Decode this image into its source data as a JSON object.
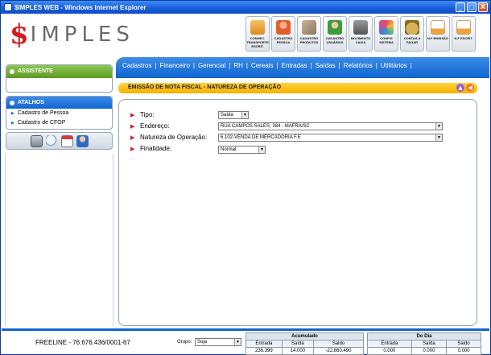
{
  "window": {
    "title": "$IMPLES WEB - Windows Internet Explorer",
    "buttons": [
      "_",
      "□",
      "X"
    ]
  },
  "logo": {
    "symbol": "$",
    "text": "IMPLES"
  },
  "toolbar": [
    {
      "label": "CONHEC. TRANSPORTE ESCRIT.",
      "icon": "truck-icon",
      "color": "#f0a23c"
    },
    {
      "label": "CADASTRO PESSOA",
      "icon": "person-icon",
      "color": "#e35d2a"
    },
    {
      "label": "CADASTRO PRODUTOS",
      "icon": "box-icon",
      "color": "#9f8a72"
    },
    {
      "label": "CADASTRO USUÁRIOS",
      "icon": "user-icon",
      "color": "#3e9c3e"
    },
    {
      "label": "MOVIMENTO CAIXA",
      "icon": "safe-icon",
      "color": "#7a7a7a"
    },
    {
      "label": "CONFIG SISTEMA",
      "icon": "palette-icon",
      "color": "#c94f9d"
    },
    {
      "label": "CONTAS A PAGAR",
      "icon": "money-bag-icon",
      "color": "#b58a2c"
    },
    {
      "label": "N.F EMISSÃO",
      "icon": "invoice-icon",
      "color": "#e8a23c"
    },
    {
      "label": "N.F ESCRIT.",
      "icon": "invoice-add-icon",
      "color": "#e8a23c"
    }
  ],
  "menu": [
    "Cadastros",
    "Financeiro",
    "Gerencial",
    "RH",
    "Cereais",
    "Entradas",
    "Saídas",
    "Relatórios",
    "Utilitários"
  ],
  "form": {
    "title": "EMISSÃO DE NOTA FISCAL - NATUREZA DE OPERAÇÃO",
    "fields": [
      {
        "label": "Tipo:",
        "value": "Saída"
      },
      {
        "label": "Endereço:",
        "value": "RUA CAMPOS SALES, 384 - MAFRA/SC"
      },
      {
        "label": "Natureza de Operação:",
        "value": "6.102-VENDA DE MERCADORIA F.E"
      },
      {
        "label": "Finalidade:",
        "value": "Normal"
      }
    ]
  },
  "sidebar": {
    "assistente": "ASSISTENTE",
    "atalhos": "ATALHOS",
    "shortcuts": [
      "Cadastro de Pessoa",
      "Cadastro de CFOP"
    ],
    "quick_icons": [
      "calculator-icon",
      "search-icon",
      "calendar-icon",
      "user-icon"
    ]
  },
  "footer": {
    "freeline": "FREELINE  -  76.676.436/0001-67",
    "grupo_label": "Grupo:",
    "grupo_value": "Soja",
    "acumulado": {
      "title": "Acumulado",
      "headers": [
        "Entrada",
        "Saída",
        "Saldo"
      ],
      "values": [
        "236.399",
        "14.000",
        "-22.860.490"
      ]
    },
    "do_dia": {
      "title": "Do Dia",
      "headers": [
        "Entrada",
        "Saída",
        "Saldo"
      ],
      "values": [
        "0.000",
        "0.000",
        "0.000"
      ]
    }
  },
  "colors": {
    "brand_red": "#d61b1b",
    "band_blue": "#0f64cf",
    "form_orange": "#f5b000"
  }
}
